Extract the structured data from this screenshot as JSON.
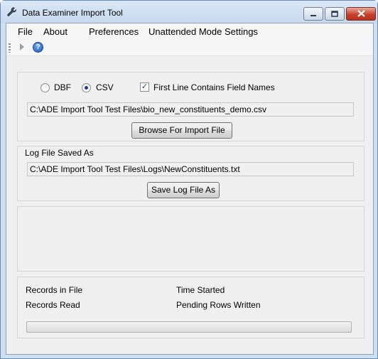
{
  "window": {
    "title": "Data Examiner Import Tool",
    "icons": {
      "app": "wrench-icon",
      "minimize": "minimize-icon",
      "maximize": "maximize-icon",
      "close": "close-icon"
    }
  },
  "menu": {
    "file": "File",
    "about": "About",
    "preferences": "Preferences",
    "unattended": "Unattended Mode Settings"
  },
  "toolbar": {
    "icons": [
      "play-icon",
      "help-icon"
    ]
  },
  "import": {
    "format_dbf": "DBF",
    "format_csv": "CSV",
    "selected_format": "CSV",
    "first_line_label": "First Line Contains Field Names",
    "first_line_checked": true,
    "file_path": "C:\\ADE Import Tool Test Files\\bio_new_constituents_demo.csv",
    "browse_button": "Browse For Import File"
  },
  "log": {
    "group_label": "Log File Saved As",
    "file_path": "C:\\ADE Import Tool Test Files\\Logs\\NewConstituents.txt",
    "save_button": "Save Log File As"
  },
  "status": {
    "records_in_file": "Records in File",
    "records_read": "Records Read",
    "time_started": "Time Started",
    "pending_rows": "Pending Rows Written",
    "progress_percent": 0
  },
  "colors": {
    "titlebar": "#cfe0f1",
    "client": "#f0f0f0",
    "close_button": "#c7412c"
  }
}
